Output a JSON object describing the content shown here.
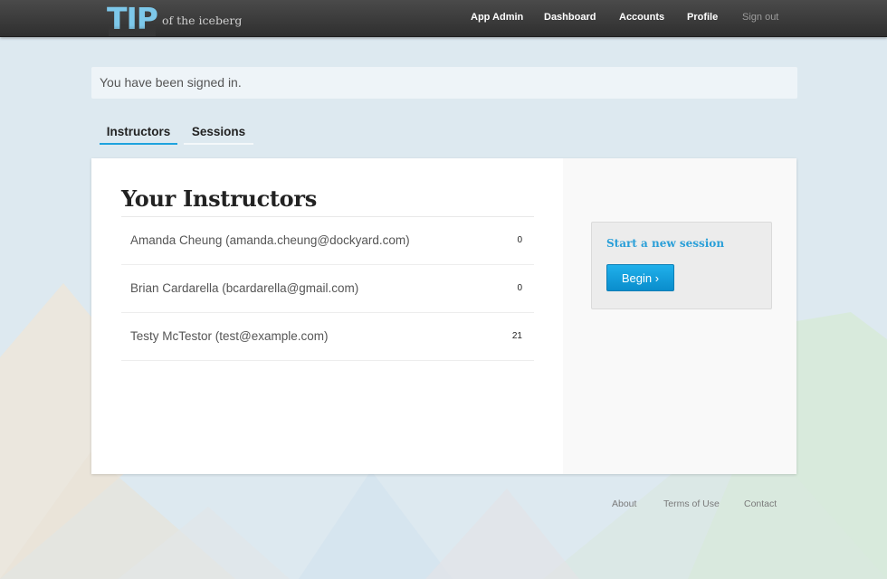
{
  "app": {
    "logo_mark": "TIP",
    "logo_sub": "of the iceberg"
  },
  "nav": {
    "items": [
      {
        "label": "App Admin"
      },
      {
        "label": "Dashboard"
      },
      {
        "label": "Accounts"
      },
      {
        "label": "Profile"
      },
      {
        "label": "Sign out"
      }
    ]
  },
  "flash": {
    "message": "You have been signed in."
  },
  "tabs": [
    {
      "label": "Instructors",
      "active": true
    },
    {
      "label": "Sessions",
      "active": false
    }
  ],
  "main": {
    "title": "Your Instructors",
    "instructors": [
      {
        "name": "Amanda Cheung (amanda.cheung@dockyard.com)",
        "count": "0"
      },
      {
        "name": "Brian Cardarella (bcardarella@gmail.com)",
        "count": "0"
      },
      {
        "name": "Testy McTestor (test@example.com)",
        "count": "21"
      }
    ]
  },
  "sidebar": {
    "session_title": "Start a new session",
    "begin_label": "Begin ›"
  },
  "footer": {
    "links": [
      {
        "label": "About"
      },
      {
        "label": "Terms of Use"
      },
      {
        "label": "Contact"
      }
    ]
  },
  "colors": {
    "accent": "#1ea3de",
    "topbar": "#3a3a3a",
    "logo": "#7dc8ea",
    "background": "#dde9f0"
  }
}
